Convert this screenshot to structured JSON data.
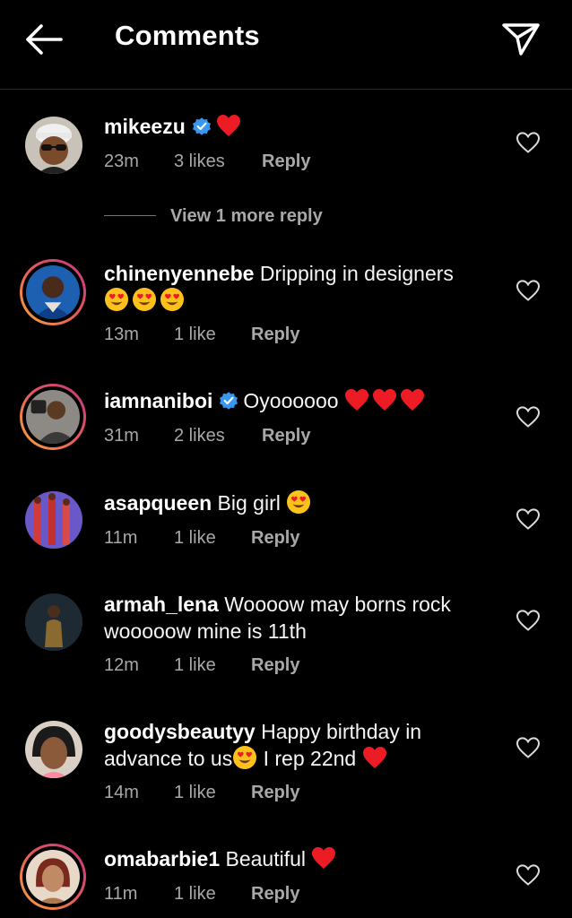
{
  "header": {
    "title": "Comments"
  },
  "colors": {
    "background": "#000000",
    "secondary_text": "#a8a8a8",
    "verified_blue": "#3897f0",
    "heart_red": "#ed1c24"
  },
  "comments": [
    {
      "username": "mikeezu",
      "verified": true,
      "text": "",
      "emojis": [
        "red-heart"
      ],
      "time": "23m",
      "likes": "3 likes",
      "reply": "Reply",
      "view_more": "View 1 more reply"
    },
    {
      "username": "chinenyennebe",
      "verified": false,
      "text": "Dripping in designers",
      "emojis": [
        "heart-eyes",
        "heart-eyes",
        "heart-eyes"
      ],
      "time": "13m",
      "likes": "1 like",
      "reply": "Reply"
    },
    {
      "username": "iamnaniboi",
      "verified": true,
      "text": "Oyoooooo",
      "emojis": [
        "red-heart",
        "red-heart",
        "red-heart"
      ],
      "time": "31m",
      "likes": "2 likes",
      "reply": "Reply"
    },
    {
      "username": "asapqueen",
      "verified": false,
      "text": "Big girl",
      "emojis": [
        "heart-eyes"
      ],
      "time": "11m",
      "likes": "1 like",
      "reply": "Reply"
    },
    {
      "username": "armah_lena",
      "verified": false,
      "text": "Woooow may borns rock wooooow mine is 11th",
      "emojis": [],
      "time": "12m",
      "likes": "1 like",
      "reply": "Reply"
    },
    {
      "username": "goodysbeautyy",
      "verified": false,
      "text": "Happy birthday in advance to us",
      "text_after": "I rep 22nd",
      "emojis": [
        "heart-eyes",
        "red-heart"
      ],
      "time": "14m",
      "likes": "1 like",
      "reply": "Reply"
    },
    {
      "username": "omabarbie1",
      "verified": false,
      "text": "Beautiful",
      "emojis": [
        "red-heart"
      ],
      "time": "11m",
      "likes": "1 like",
      "reply": "Reply"
    }
  ]
}
